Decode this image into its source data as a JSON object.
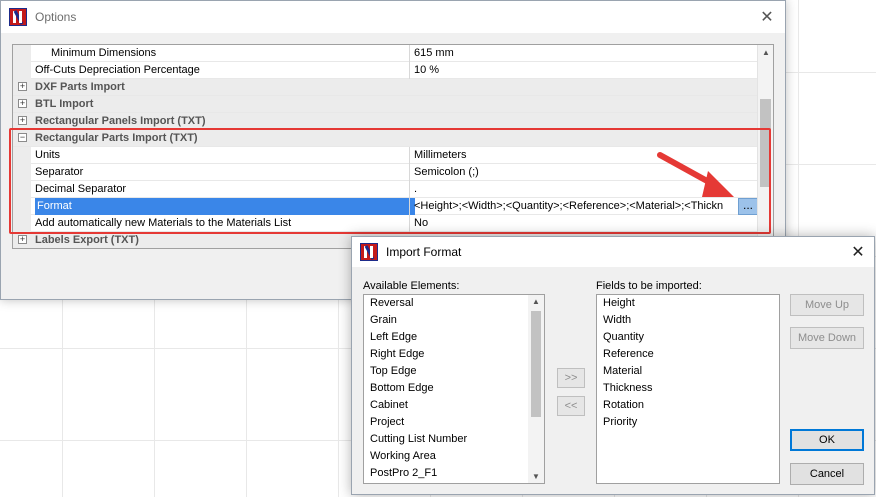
{
  "options_window": {
    "title": "Options",
    "rows": [
      {
        "type": "property",
        "name": "Minimum Dimensions",
        "value": "615 mm",
        "indent": true
      },
      {
        "type": "property",
        "name": "Off-Cuts Depreciation Percentage",
        "value": "10 %"
      },
      {
        "type": "category",
        "name": "DXF Parts Import",
        "expander": "+"
      },
      {
        "type": "category",
        "name": "BTL Import",
        "expander": "+"
      },
      {
        "type": "category",
        "name": "Rectangular Panels Import (TXT)",
        "expander": "+"
      },
      {
        "type": "category",
        "name": "Rectangular Parts Import (TXT)",
        "expander": "−"
      },
      {
        "type": "property",
        "name": "Units",
        "value": "Millimeters"
      },
      {
        "type": "property",
        "name": "Separator",
        "value": "Semicolon (;)"
      },
      {
        "type": "property",
        "name": "Decimal Separator",
        "value": "."
      },
      {
        "type": "property",
        "name": "Format",
        "value": "<Height>;<Width>;<Quantity>;<Reference>;<Material>;<Thickn",
        "selected": true,
        "ellipsis": "..."
      },
      {
        "type": "property",
        "name": "Add automatically new Materials to the Materials List",
        "value": "No"
      },
      {
        "type": "category",
        "name": "Labels Export (TXT)",
        "expander": "+"
      }
    ]
  },
  "import_dialog": {
    "title": "Import Format",
    "available_label": "Available Elements:",
    "fields_label": "Fields to be imported:",
    "available_elements": [
      "Reversal",
      "Grain",
      "Left Edge",
      "Right Edge",
      "Top Edge",
      "Bottom Edge",
      "Cabinet",
      "Project",
      "Cutting List Number",
      "Working Area",
      "PostPro 2_F1"
    ],
    "fields_to_import": [
      "Height",
      "Width",
      "Quantity",
      "Reference",
      "Material",
      "Thickness",
      "Rotation",
      "Priority"
    ],
    "buttons": {
      "add": ">>",
      "remove": "<<",
      "move_up": "Move Up",
      "move_down": "Move Down",
      "ok": "OK",
      "cancel": "Cancel"
    }
  },
  "colors": {
    "highlight": "#e53935",
    "selection": "#3a86e8"
  }
}
